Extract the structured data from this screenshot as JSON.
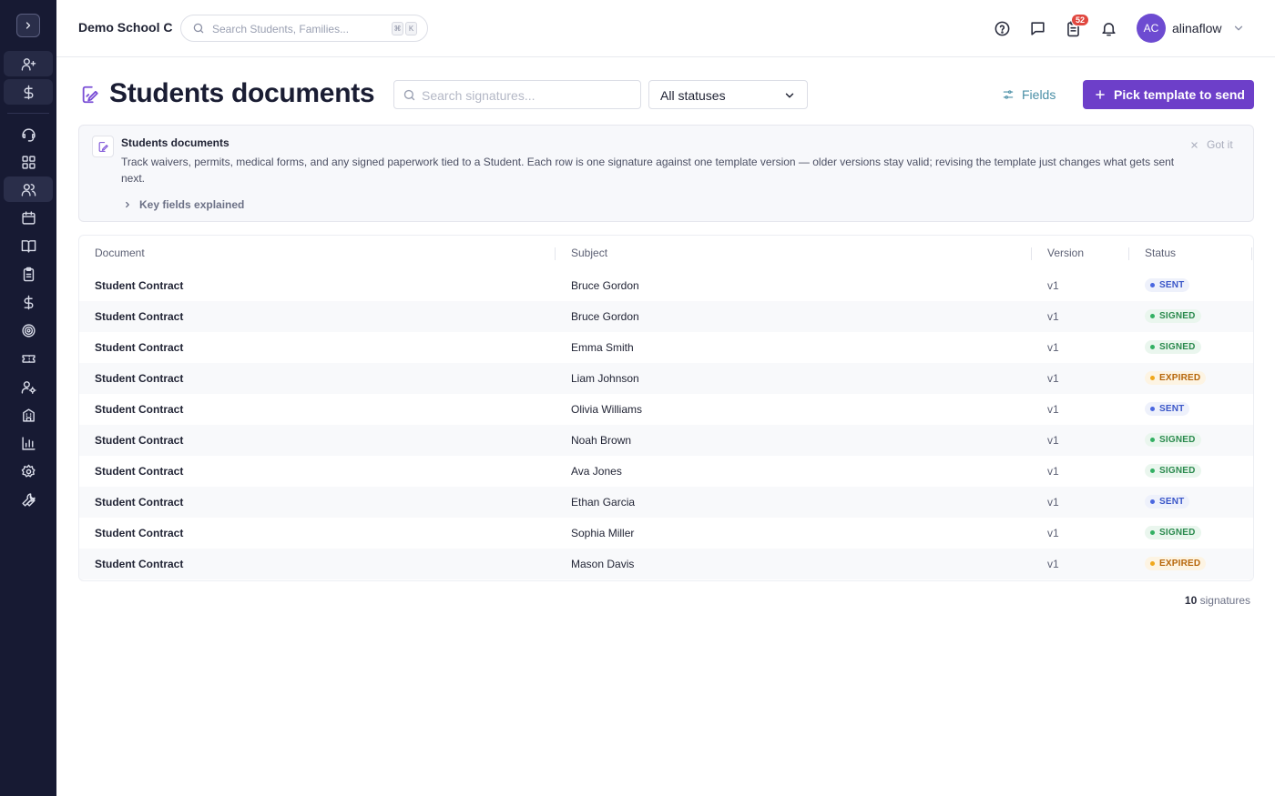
{
  "header": {
    "school_name": "Demo School C",
    "search_placeholder": "Search Students, Families...",
    "shortcut_keys": [
      "⌘",
      "K"
    ],
    "notification_count": "52",
    "avatar_initials": "AC",
    "username": "alinaflow"
  },
  "sidebar": {
    "items": [
      {
        "icon": "user-plus-icon"
      },
      {
        "icon": "dollar-icon"
      },
      {
        "icon": "headset-icon"
      },
      {
        "icon": "dashboard-icon"
      },
      {
        "icon": "users-icon"
      },
      {
        "icon": "calendar-icon"
      },
      {
        "icon": "book-icon"
      },
      {
        "icon": "clipboard-icon"
      },
      {
        "icon": "dollar-icon"
      },
      {
        "icon": "target-icon"
      },
      {
        "icon": "ticket-icon"
      },
      {
        "icon": "user-gear-icon"
      },
      {
        "icon": "building-icon"
      },
      {
        "icon": "bar-chart-icon"
      },
      {
        "icon": "settings-icon"
      },
      {
        "icon": "wrench-icon"
      }
    ]
  },
  "page": {
    "title": "Students documents",
    "search_placeholder": "Search signatures...",
    "status_filter": "All statuses",
    "fields_label": "Fields",
    "primary_action": "Pick template to send"
  },
  "info": {
    "title": "Students documents",
    "body": "Track waivers, permits, medical forms, and any signed paperwork tied to a Student. Each row is one signature against one template version — older versions stay valid; revising the template just changes what gets sent next.",
    "key_fields": "Key fields explained",
    "dismiss": "Got it"
  },
  "table": {
    "columns": [
      "Document",
      "Subject",
      "Version",
      "Status"
    ],
    "rows": [
      {
        "document": "Student Contract",
        "subject": "Bruce Gordon",
        "version": "v1",
        "status": "SENT"
      },
      {
        "document": "Student Contract",
        "subject": "Bruce Gordon",
        "version": "v1",
        "status": "SIGNED"
      },
      {
        "document": "Student Contract",
        "subject": "Emma Smith",
        "version": "v1",
        "status": "SIGNED"
      },
      {
        "document": "Student Contract",
        "subject": "Liam Johnson",
        "version": "v1",
        "status": "EXPIRED"
      },
      {
        "document": "Student Contract",
        "subject": "Olivia Williams",
        "version": "v1",
        "status": "SENT"
      },
      {
        "document": "Student Contract",
        "subject": "Noah Brown",
        "version": "v1",
        "status": "SIGNED"
      },
      {
        "document": "Student Contract",
        "subject": "Ava Jones",
        "version": "v1",
        "status": "SIGNED"
      },
      {
        "document": "Student Contract",
        "subject": "Ethan Garcia",
        "version": "v1",
        "status": "SENT"
      },
      {
        "document": "Student Contract",
        "subject": "Sophia Miller",
        "version": "v1",
        "status": "SIGNED"
      },
      {
        "document": "Student Contract",
        "subject": "Mason Davis",
        "version": "v1",
        "status": "EXPIRED"
      }
    ]
  },
  "status_colors": {
    "SENT": {
      "text": "#3a56c8",
      "bg": "#eef1fb",
      "dot": "#4a67e0"
    },
    "SIGNED": {
      "text": "#2b8a4e",
      "bg": "#eaf6ee",
      "dot": "#33b063"
    },
    "EXPIRED": {
      "text": "#b6660a",
      "bg": "#fdf4e3",
      "dot": "#f0a81c"
    }
  },
  "footer": {
    "count": "10",
    "count_label": "signatures"
  },
  "colors": {
    "sidebar_bg": "#171a33",
    "accent": "#6d3fc9",
    "fields_link": "#4a8fa6"
  }
}
